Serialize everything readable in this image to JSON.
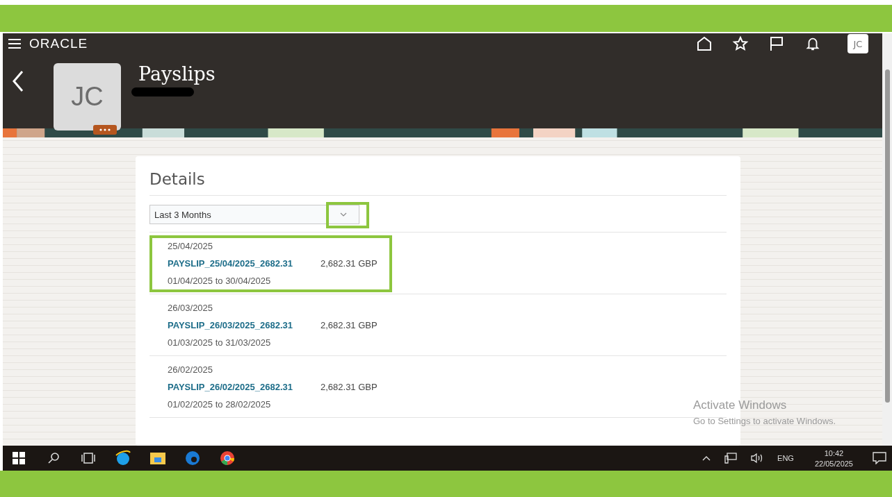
{
  "header": {
    "brand": "ORACLE",
    "page_title": "Payslips",
    "avatar_initials": "JC",
    "user_initials": "JC"
  },
  "details": {
    "title": "Details",
    "period_filter": {
      "value": "Last 3 Months",
      "highlighted": true
    },
    "payslips": [
      {
        "date": "25/04/2025",
        "name": "PAYSLIP_25/04/2025_2682.31",
        "amount": "2,682.31 GBP",
        "period": "01/04/2025 to 30/04/2025",
        "highlighted": true
      },
      {
        "date": "26/03/2025",
        "name": "PAYSLIP_26/03/2025_2682.31",
        "amount": "2,682.31 GBP",
        "period": "01/03/2025 to 31/03/2025",
        "highlighted": false
      },
      {
        "date": "26/02/2025",
        "name": "PAYSLIP_26/02/2025_2682.31",
        "amount": "2,682.31 GBP",
        "period": "01/02/2025 to 28/02/2025",
        "highlighted": false
      }
    ]
  },
  "activation_notice": {
    "title": "Activate Windows",
    "message": "Go to Settings to activate Windows."
  },
  "taskbar": {
    "language": "ENG",
    "time": "10:42",
    "date": "22/05/2025"
  }
}
